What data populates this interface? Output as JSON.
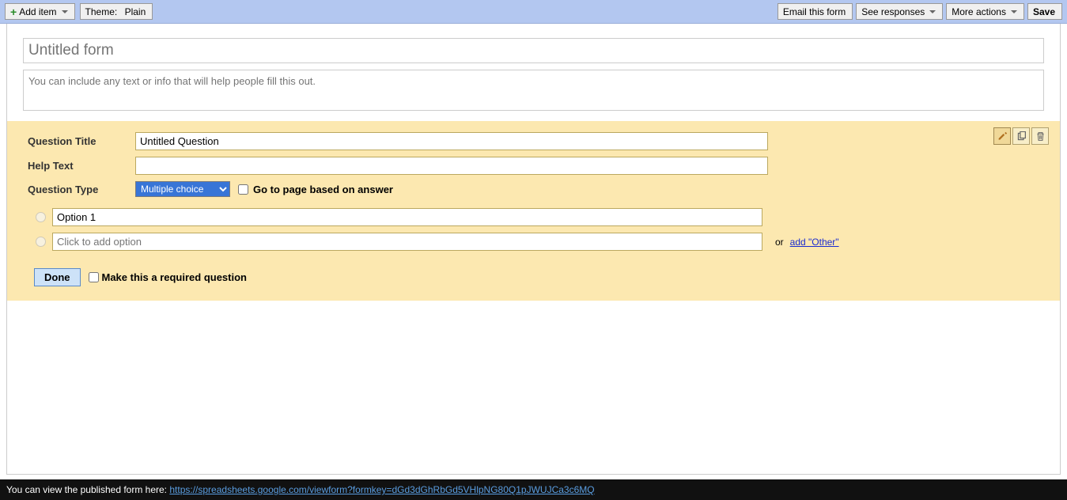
{
  "toolbar": {
    "add_item_label": "Add item",
    "theme_label": "Theme:",
    "theme_value": "Plain",
    "email_form_label": "Email this form",
    "see_responses_label": "See responses",
    "more_actions_label": "More actions",
    "save_label": "Save"
  },
  "form_header": {
    "title_placeholder": "Untitled form",
    "title_value": "",
    "description_placeholder": "You can include any text or info that will help people fill this out.",
    "description_value": ""
  },
  "question": {
    "title_label": "Question Title",
    "title_value": "Untitled Question",
    "help_label": "Help Text",
    "help_value": "",
    "type_label": "Question Type",
    "type_value": "Multiple choice",
    "go_to_page_label": "Go to page based on answer",
    "go_to_page_checked": false,
    "options": [
      {
        "value": "Option 1"
      }
    ],
    "add_option_placeholder": "Click to add option",
    "or_text": "or",
    "add_other_label": "add \"Other\"",
    "done_label": "Done",
    "required_label": "Make this a required question",
    "required_checked": false
  },
  "question_tools": {
    "edit_icon": "pencil-icon",
    "duplicate_icon": "copy-icon",
    "delete_icon": "trash-icon"
  },
  "footer": {
    "prefix": "You can view the published form here: ",
    "link": "https://spreadsheets.google.com/viewform?formkey=dGd3dGhRbGd5VHlpNG80Q1pJWUJCa3c6MQ"
  }
}
